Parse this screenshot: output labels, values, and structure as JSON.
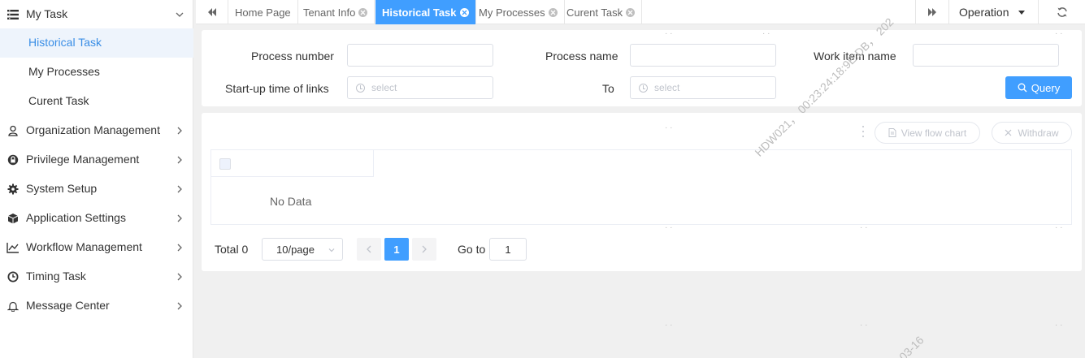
{
  "sidebar": {
    "group": {
      "label": "My Task",
      "icon": "menu-icon",
      "expanded": true
    },
    "subitems": [
      {
        "label": "Historical Task",
        "active": true
      },
      {
        "label": "My Processes",
        "active": false
      },
      {
        "label": "Curent Task",
        "active": false
      }
    ],
    "items": [
      {
        "label": "Organization Management",
        "icon": "user-icon"
      },
      {
        "label": "Privilege Management",
        "icon": "lock-icon"
      },
      {
        "label": "System Setup",
        "icon": "gear-icon"
      },
      {
        "label": "Application Settings",
        "icon": "cube-icon"
      },
      {
        "label": "Workflow Management",
        "icon": "chart-line-icon"
      },
      {
        "label": "Timing Task",
        "icon": "clock-icon"
      },
      {
        "label": "Message Center",
        "icon": "bell-icon"
      }
    ]
  },
  "tabs": [
    {
      "label": "Home Page",
      "closable": false,
      "active": false
    },
    {
      "label": "Tenant Info",
      "closable": true,
      "active": false
    },
    {
      "label": "Historical Task",
      "closable": true,
      "active": true
    },
    {
      "label": "My Processes",
      "closable": true,
      "active": false
    },
    {
      "label": "Curent Task",
      "closable": true,
      "active": false
    }
  ],
  "tabbar": {
    "operation_label": "Operation"
  },
  "search": {
    "process_number_label": "Process number",
    "process_name_label": "Process name",
    "work_item_name_label": "Work item name",
    "startup_time_label": "Start-up time of links",
    "to_label": "To",
    "date_placeholder": "select",
    "query_label": "Query"
  },
  "table": {
    "view_flow_chart_label": "View flow chart",
    "withdraw_label": "Withdraw",
    "empty_text": "No Data"
  },
  "pagination": {
    "total_text": "Total 0",
    "page_size": "10/page",
    "current_page": "1",
    "goto_label": "Go to",
    "goto_value": "1"
  },
  "watermark": {
    "text": "HDW021， 00:23:24:18:9E:DB， 202",
    "date_fragment": "03-16"
  },
  "colors": {
    "accent": "#409eff",
    "active_bg": "#eef4fc",
    "page_bg": "#f0f0f0"
  }
}
